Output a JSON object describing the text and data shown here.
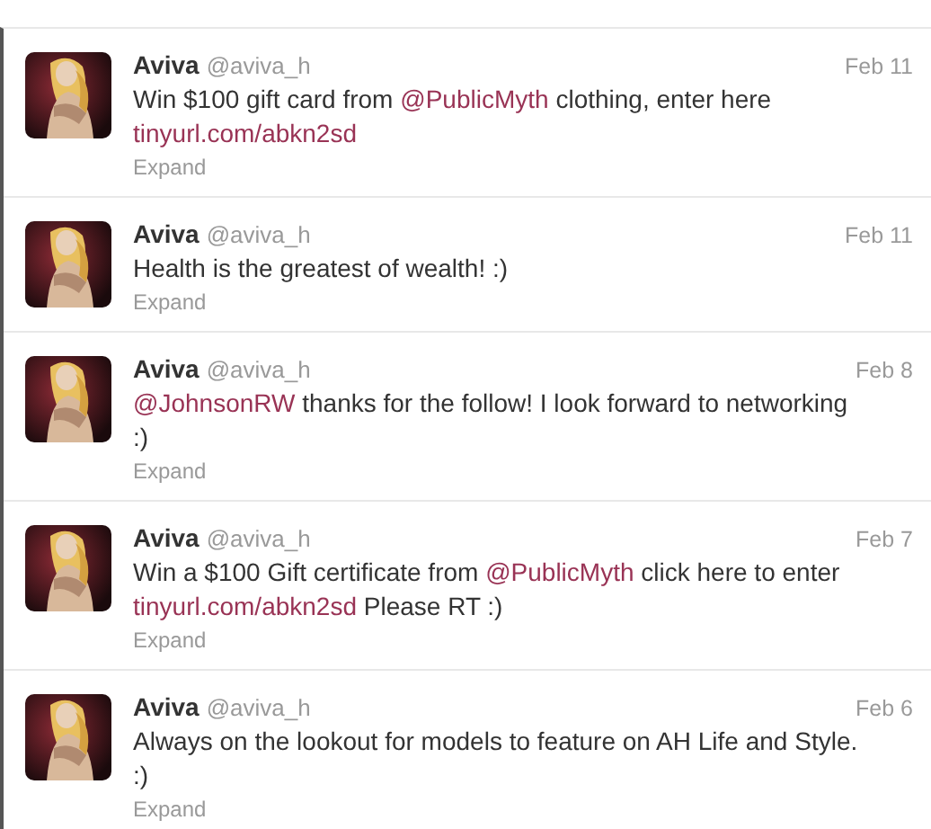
{
  "tweets": [
    {
      "name": "Aviva",
      "handle": "@aviva_h",
      "date": "Feb 11",
      "text": [
        {
          "kind": "text",
          "s": "Win $100 gift card from "
        },
        {
          "kind": "mention",
          "s": "@PublicMyth"
        },
        {
          "kind": "text",
          "s": " clothing, enter here "
        },
        {
          "kind": "link",
          "s": "tinyurl.com/abkn2sd"
        }
      ],
      "action": "Expand"
    },
    {
      "name": "Aviva",
      "handle": "@aviva_h",
      "date": "Feb 11",
      "text": [
        {
          "kind": "text",
          "s": "Health is the greatest of wealth! :)"
        }
      ],
      "action": "Expand"
    },
    {
      "name": "Aviva",
      "handle": "@aviva_h",
      "date": "Feb 8",
      "text": [
        {
          "kind": "mention",
          "s": "@JohnsonRW"
        },
        {
          "kind": "text",
          "s": " thanks for the follow! I look forward to networking :)"
        }
      ],
      "action": "Expand"
    },
    {
      "name": "Aviva",
      "handle": "@aviva_h",
      "date": "Feb 7",
      "text": [
        {
          "kind": "text",
          "s": "Win a $100 Gift certificate from "
        },
        {
          "kind": "mention",
          "s": "@PublicMyth"
        },
        {
          "kind": "text",
          "s": " click here to enter "
        },
        {
          "kind": "link",
          "s": "tinyurl.com/abkn2sd"
        },
        {
          "kind": "text",
          "s": " Please RT :)"
        }
      ],
      "action": "Expand"
    },
    {
      "name": "Aviva",
      "handle": "@aviva_h",
      "date": "Feb 6",
      "text": [
        {
          "kind": "text",
          "s": "Always on the lookout for models to feature on AH Life and Style. :)"
        }
      ],
      "action": "Expand"
    }
  ]
}
